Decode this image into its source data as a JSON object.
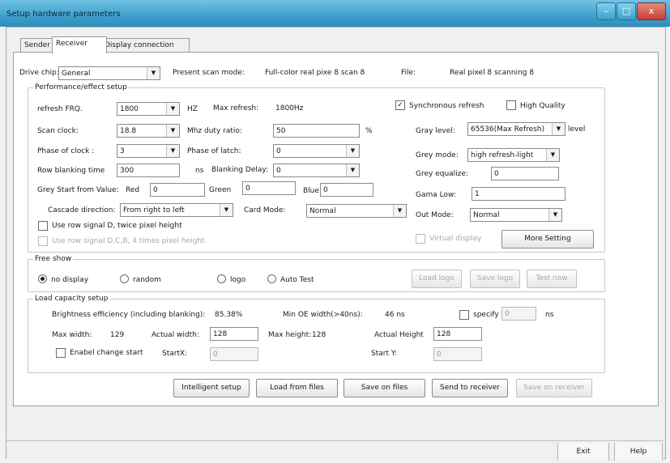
{
  "window": {
    "title": "Setup hardware parameters",
    "minimize": "–",
    "maximize": "□",
    "close": "x"
  },
  "tabs": [
    "Sender",
    "Receiver",
    "Display connection"
  ],
  "top_row": {
    "drive_chip_label": "Drive chip:",
    "drive_chip_value": "General",
    "present_scan_label": "Present scan mode:",
    "present_scan_value": "Full-color real pixe 8 scan 8",
    "file_label": "File:",
    "file_value": "Real pixel 8 scanning 8"
  },
  "perf": {
    "title": "Performance/effect setup",
    "refresh_label": "refresh FRQ.",
    "refresh_value": "1800",
    "refresh_unit": "HZ",
    "max_refresh_label": "Max refresh:",
    "max_refresh_value": "1800Hz",
    "scan_clock_label": "Scan clock:",
    "scan_clock_value": "18.8",
    "scan_clock_unit": "Mhz",
    "duty_label": "duty ratio:",
    "duty_value": "50",
    "duty_unit": "%",
    "phase_clock_label": "Phase of clock :",
    "phase_clock_value": "3",
    "phase_latch_label": "Phase of latch:",
    "phase_latch_value": "0",
    "row_blank_label": "Row blanking time",
    "row_blank_value": "300",
    "row_blank_unit": "ns",
    "blank_delay_label": "Blanking Delay:",
    "blank_delay_value": "0",
    "grey_start_label": "Grey Start from Value:",
    "red_label": "Red",
    "red_value": "0",
    "green_label": "Green",
    "green_value": "0",
    "blue_label": "Blue",
    "blue_value": "0",
    "cascade_label": "Cascade direction:",
    "cascade_value": "From right to left",
    "card_mode_label": "Card Mode:",
    "card_mode_value": "Normal",
    "use_row_d_label": "Use row signal D, twice pixel height",
    "use_row_dcb_label": "Use row signal D,C,B, 4 times pixel height",
    "sync_refresh_label": "Synchronous refresh",
    "high_quality_label": "High Quality",
    "gray_level_label": "Gray level:",
    "gray_level_value": "65536(Max Refresh)",
    "gray_level_unit": "level",
    "grey_mode_label": "Grey mode:",
    "grey_mode_value": "high refresh-light",
    "grey_equalize_label": "Grey equalize:",
    "grey_equalize_value": "0",
    "gama_low_label": "Gama Low:",
    "gama_low_value": "1",
    "out_mode_label": "Out Mode:",
    "out_mode_value": "Normal",
    "virtual_label": "Virtual display",
    "more_setting": "More Setting"
  },
  "free_show": {
    "title": "Free show",
    "opt_no_display": "no display",
    "opt_random": "random",
    "opt_logo": "logo",
    "opt_auto_test": "Auto Test",
    "load_logo": "Load logo",
    "save_logo": "Save logo",
    "test_now": "Test now"
  },
  "load": {
    "title": "Load capacity setup",
    "brightness_label": "Brightness efficiency (including blanking):",
    "brightness_value": "85.38%",
    "min_oe_label": "Min OE width(>40ns):",
    "min_oe_value": "46 ns",
    "specify_label": "specify",
    "specify_value": "0",
    "specify_unit": "ns",
    "max_width_label": "Max width:",
    "max_width_value": "129",
    "actual_width_label": "Actual width:",
    "actual_width_value": "128",
    "max_height_label": "Max height:",
    "max_height_value": "128",
    "actual_height_label": "Actual Height",
    "actual_height_value": "128",
    "enable_change_label": "Enabel change start",
    "startx_label": "StartX:",
    "startx_value": "0",
    "starty_label": "Start Y:",
    "starty_value": "0"
  },
  "actions": {
    "intelligent": "Intelligent setup",
    "load_files": "Load from files",
    "save_files": "Save on files",
    "send": "Send to receiver",
    "save_receiver": "Save on receiver"
  },
  "bottom": {
    "exit": "Exit",
    "help": "Help"
  },
  "colors": {
    "titlebar": "#3fa0cc",
    "close": "#c63f33"
  }
}
